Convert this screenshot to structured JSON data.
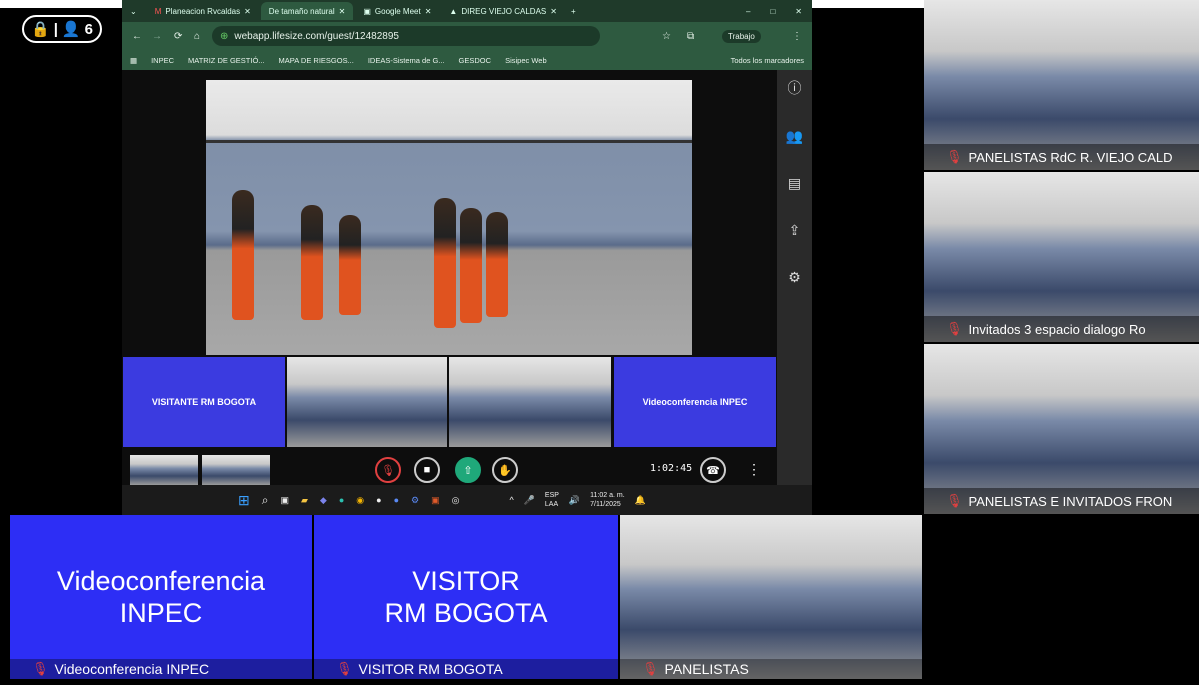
{
  "meeting": {
    "participant_count": "6"
  },
  "browser": {
    "tabs": [
      "Planeacion Rvcaldas",
      "De tamaño natural",
      "Google Meet",
      "DIREG VIEJO CALDAS"
    ],
    "url": "webapp.lifesize.com/guest/12482895",
    "profile": "Trabajo",
    "bookmarks": [
      "INPEC",
      "MATRIZ DE GESTIÓ...",
      "MAPA DE RIESGOS...",
      "IDEAS-Sistema de G...",
      "GESDOC",
      "Sisipec Web",
      "Todos los marcadores"
    ]
  },
  "shared": {
    "thumbs": {
      "left": "VISITANTE RM BOGOTA",
      "right": "Videoconferencia INPEC"
    },
    "timer": "1:02:45"
  },
  "taskbar": {
    "lang1": "ESP",
    "lang2": "LAA",
    "time": "11:02 a. m.",
    "date": "7/11/2025"
  },
  "right_tiles": [
    {
      "label": "PANELISTAS RdC R. VIEJO CALD"
    },
    {
      "label": "Invitados 3 espacio dialogo Ro"
    },
    {
      "label": "PANELISTAS E INVITADOS FRON"
    }
  ],
  "bottom_tiles": [
    {
      "line1": "Videoconferencia",
      "line2": "INPEC",
      "label": "Videoconferencia INPEC"
    },
    {
      "line1": "VISITOR",
      "line2": "RM BOGOTA",
      "label": "VISITOR RM BOGOTA"
    },
    {
      "label": "PANELISTAS"
    }
  ],
  "colors": {
    "tile_purple": "#2d2ef5",
    "muted_mic": "#e04040",
    "browser_green": "#2e5a40"
  }
}
